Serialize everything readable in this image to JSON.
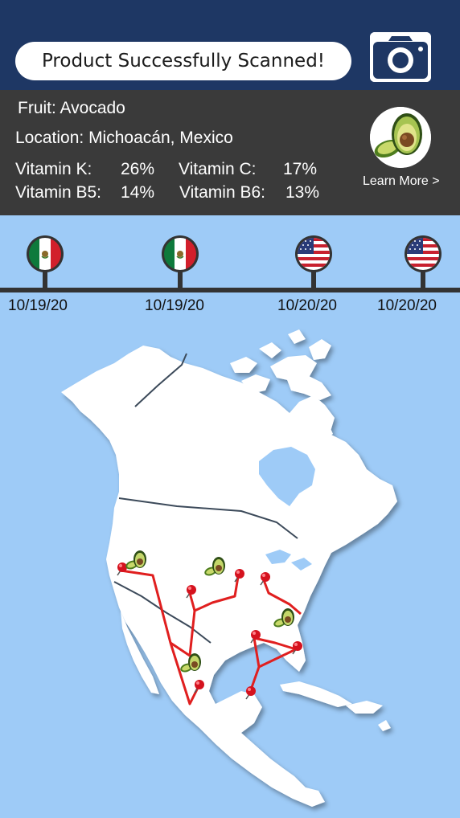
{
  "header": {
    "status_message": "Product Successfully Scanned!",
    "camera_icon": "camera-icon",
    "background_color": "#1e3764"
  },
  "product": {
    "fruit": "Fruit: Avocado",
    "location": "Location: Michoacán, Mexico",
    "vitamins": {
      "k_label": "Vitamin K:",
      "k_value": "26%",
      "c_label": "Vitamin C:",
      "c_value": "17%",
      "b5_label": "Vitamin B5:",
      "b5_value": "14%",
      "b6_label": "Vitamin B6:",
      "b6_value": "13%"
    },
    "image_icon": "avocado-icon",
    "learn_more": "Learn More >"
  },
  "timeline": {
    "stops": [
      {
        "flag": "mexico-flag-icon",
        "date": "10/19/20"
      },
      {
        "flag": "mexico-flag-icon",
        "date": "10/19/20"
      },
      {
        "flag": "usa-flag-icon",
        "date": "10/20/20"
      },
      {
        "flag": "usa-flag-icon",
        "date": "10/20/20"
      }
    ]
  },
  "map": {
    "region": "North America",
    "route_color": "#e01f1f",
    "markers": [
      "avocado-icon",
      "map-pin-icon"
    ]
  }
}
